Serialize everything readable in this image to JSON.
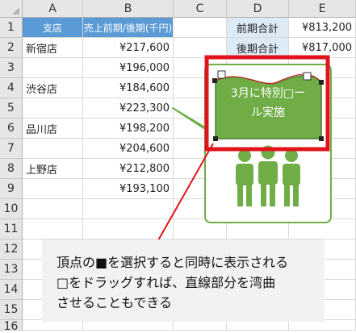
{
  "columns": [
    "A",
    "B",
    "C",
    "D",
    "E"
  ],
  "rows": [
    "1",
    "2",
    "3",
    "4",
    "5",
    "6",
    "7",
    "8",
    "9",
    "10",
    "11",
    "12",
    "13",
    "14",
    "15",
    "16"
  ],
  "table": {
    "header_store": "支店",
    "header_sales": "売上前期/後期(千円)",
    "stores": [
      "新宿店",
      "",
      "渋谷店",
      "",
      "品川店",
      "",
      "上野店",
      ""
    ],
    "sales": [
      "¥217,600",
      "¥196,000",
      "¥184,600",
      "¥223,300",
      "¥198,200",
      "¥204,600",
      "¥212,800",
      "¥193,100"
    ]
  },
  "summary": {
    "prev_label": "前期合計",
    "prev_value": "¥813,200",
    "next_label": "後期合計",
    "next_value": "¥817,000"
  },
  "shape": {
    "line1": "3月に特別□ー",
    "line2": "ル実施",
    "fill_color": "#70ad47",
    "highlight_color": "#e0131a"
  },
  "caption": {
    "line1": "頂点の■を選択すると同時に表示される",
    "line2": "□をドラッグすれば、直線部分を湾曲",
    "line3": "させることもできる"
  }
}
